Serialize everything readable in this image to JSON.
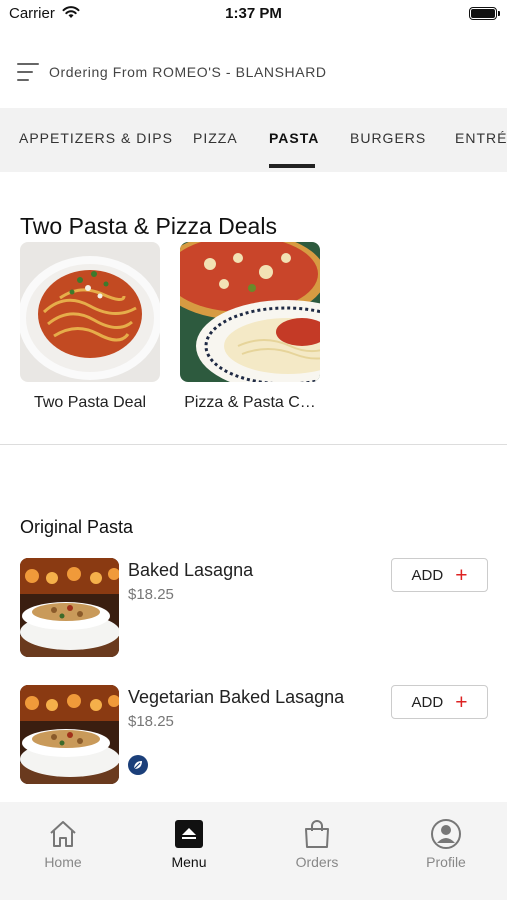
{
  "status_bar": {
    "carrier": "Carrier",
    "time": "1:37 PM"
  },
  "header": {
    "ordering_text": "Ordering From ROMEO'S - BLANSHARD"
  },
  "tabs": [
    {
      "label": "APPETIZERS & DIPS"
    },
    {
      "label": "PIZZA"
    },
    {
      "label": "PASTA",
      "active": true
    },
    {
      "label": "BURGERS"
    },
    {
      "label": "ENTRÉE"
    }
  ],
  "deals": {
    "title": "Two Pasta & Pizza Deals",
    "items": [
      {
        "label": "Two Pasta Deal"
      },
      {
        "label": "Pizza & Pasta C…"
      }
    ]
  },
  "original_pasta": {
    "title": "Original Pasta",
    "items": [
      {
        "name": "Baked Lasagna",
        "price": "$18.25",
        "add_label": "ADD"
      },
      {
        "name": "Vegetarian Baked Lasagna",
        "price": "$18.25",
        "add_label": "ADD",
        "vegetarian_badge": true
      }
    ]
  },
  "bottom_nav": [
    {
      "label": "Home",
      "icon": "home-icon"
    },
    {
      "label": "Menu",
      "icon": "menu-icon",
      "active": true
    },
    {
      "label": "Orders",
      "icon": "shopping-bag-icon"
    },
    {
      "label": "Profile",
      "icon": "profile-icon"
    }
  ],
  "colors": {
    "accent_red": "#d22222",
    "tab_bar_bg": "#f2f2f2",
    "veg_badge": "#1b3f7a"
  }
}
